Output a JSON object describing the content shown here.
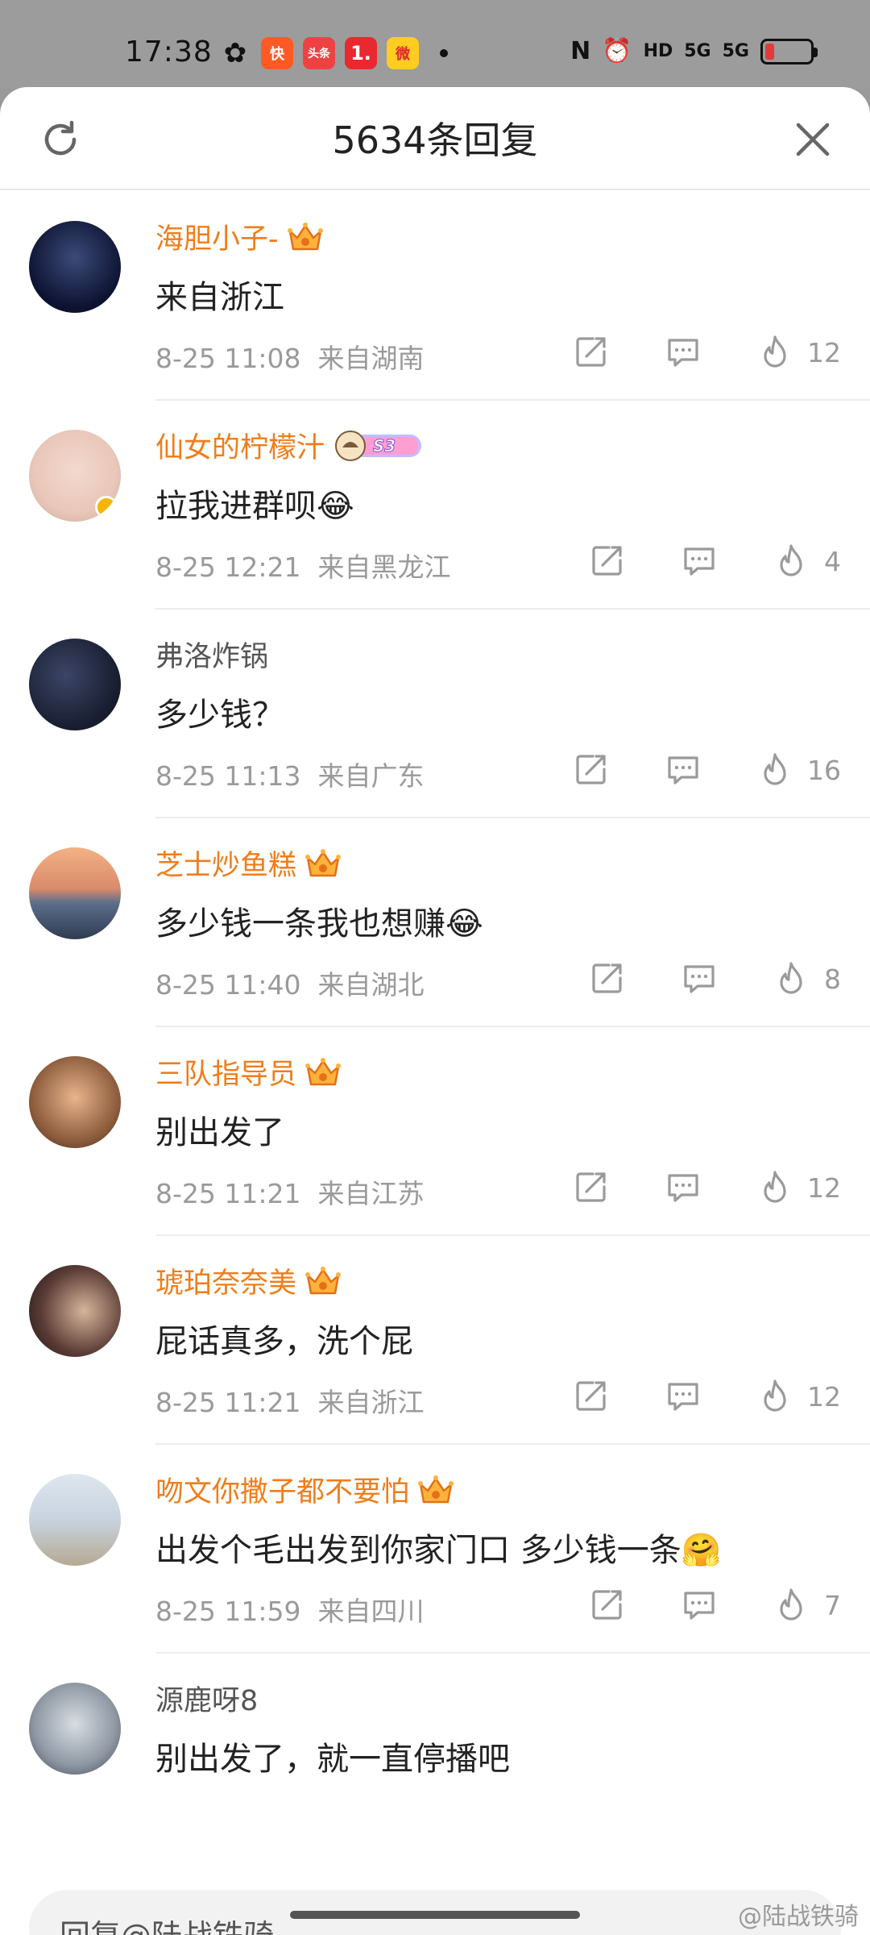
{
  "status_bar": {
    "time": "17:38",
    "apps": [
      {
        "name": "wechat-icon",
        "glyph": "✿"
      },
      {
        "name": "kuaishou-icon",
        "glyph": "快"
      },
      {
        "name": "toutiao-icon",
        "glyph": "头条"
      },
      {
        "name": "app-one-icon",
        "glyph": "1."
      },
      {
        "name": "weibo-icon",
        "glyph": "微"
      }
    ],
    "hd_label": "HD",
    "signal1_label": "5G",
    "signal2_label": "5G",
    "battery_level": 0.2,
    "battery_color": "#e23a3a"
  },
  "header": {
    "title": "5634条回复"
  },
  "comments": [
    {
      "name": "海胆小子-",
      "vip": true,
      "badge": "crown",
      "text": "来自浙江",
      "time": "8-25 11:08",
      "location": "来自湖南",
      "likes": "12"
    },
    {
      "name": "仙女的柠檬汁",
      "vip": true,
      "badge": "s3",
      "badge_label": "S3",
      "text": "拉我进群呗😂",
      "time": "8-25 12:21",
      "location": "来自黑龙江",
      "likes": "4"
    },
    {
      "name": "弗洛炸锅",
      "vip": false,
      "badge": "",
      "text": "多少钱？",
      "time": "8-25 11:13",
      "location": "来自广东",
      "likes": "16"
    },
    {
      "name": "芝士炒鱼糕",
      "vip": true,
      "badge": "crown",
      "text": "多少钱一条我也想赚😂",
      "time": "8-25 11:40",
      "location": "来自湖北",
      "likes": "8"
    },
    {
      "name": "三队指导员",
      "vip": true,
      "badge": "crown",
      "text": "别出发了",
      "time": "8-25 11:21",
      "location": "来自江苏",
      "likes": "12"
    },
    {
      "name": "琥珀奈奈美",
      "vip": true,
      "badge": "crown",
      "text": "屁话真多，洗个屁",
      "time": "8-25 11:21",
      "location": "来自浙江",
      "likes": "12"
    },
    {
      "name": "吻文你撒子都不要怕",
      "vip": true,
      "badge": "crown",
      "text": "出发个毛出发到你家门口 多少钱一条🤗",
      "time": "8-25 11:59",
      "location": "来自四川",
      "likes": "7"
    },
    {
      "name": "源鹿呀8",
      "vip": false,
      "badge": "",
      "text": "别出发了，就一直停播吧",
      "time": "",
      "location": "",
      "likes": ""
    }
  ],
  "reply_bar": {
    "placeholder": "回复@陆战铁骑"
  },
  "watermark": "@陆战铁骑",
  "colors": {
    "vip_name": "#f07d1a",
    "plain_name": "#555555",
    "meta": "#9a9a9a"
  }
}
